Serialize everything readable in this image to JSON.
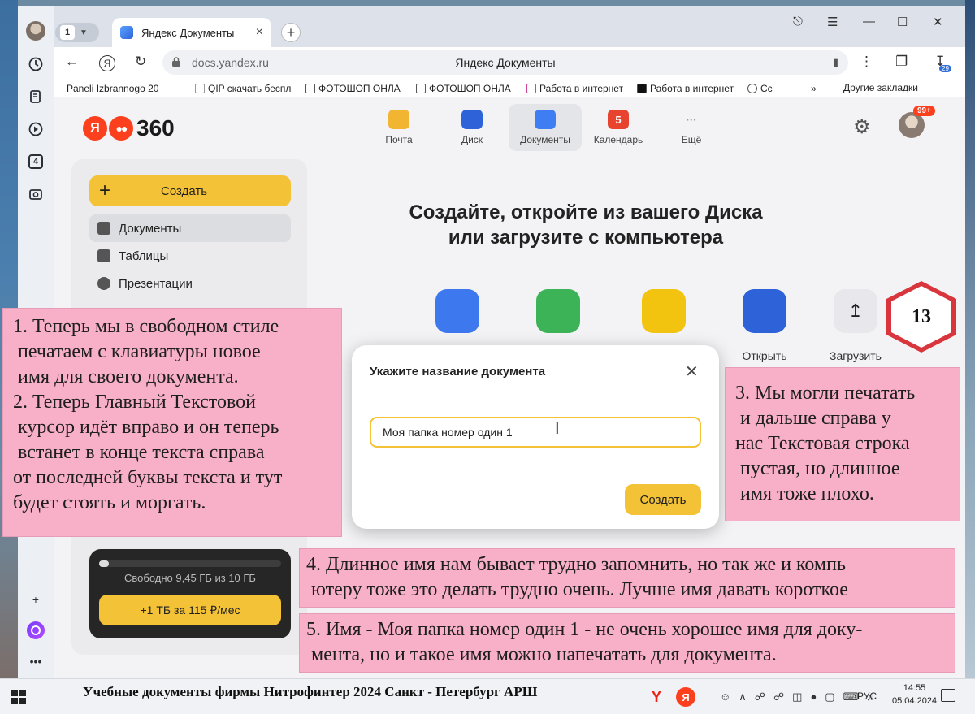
{
  "browser": {
    "tab_count": "1",
    "tab_title": "Яндекс Документы",
    "url": "docs.yandex.ru",
    "page_title": "Яндекс Документы",
    "downloads_badge": "29",
    "bookmarks": [
      "Paneli Izbrannogo 20",
      "QIP скачать беспл",
      "ФОТОШОП ОНЛА",
      "ФОТОШОП ОНЛА",
      "Работа в интернет",
      "Работа в интернет",
      "Сс"
    ],
    "bookmarks_more": "»",
    "bookmarks_other": "Другие закладки"
  },
  "sidepanel": {
    "badge_number": "4"
  },
  "header": {
    "logo_ya": "Я",
    "logo_360": "360",
    "services": [
      {
        "label": "Почта",
        "color": "#f2b531"
      },
      {
        "label": "Диск",
        "color": "#2e62d9"
      },
      {
        "label": "Документы",
        "color": "#3f7df2"
      },
      {
        "label": "Календарь",
        "color": "#e8432f",
        "icon_text": "5"
      },
      {
        "label": "Ещё",
        "color": "#c9cbd1",
        "icon_text": "···"
      }
    ],
    "user_badge": "99+"
  },
  "sidebar": {
    "create_label": "Создать",
    "items": [
      {
        "label": "Документы"
      },
      {
        "label": "Таблицы"
      },
      {
        "label": "Презентации"
      }
    ],
    "storage_text": "Свободно 9,45 ГБ из 10 ГБ",
    "storage_used_fraction": 0.055,
    "storage_button": "+1 ТБ за 115 ₽/мес"
  },
  "main": {
    "title_line1": "Создайте, откройте из вашего Диска",
    "title_line2": "или загрузите с компьютера",
    "tiles": [
      {
        "label": "",
        "color": "#3d78ee"
      },
      {
        "label": "",
        "color": "#3db357"
      },
      {
        "label": "",
        "color": "#f2c40f"
      },
      {
        "label": "Открыть",
        "color": "#2e62d9"
      },
      {
        "label": "Загрузить",
        "color": "#ececef"
      }
    ]
  },
  "dialog": {
    "title": "Укажите название документа",
    "input_value": "Моя папка номер один 1",
    "button": "Создать"
  },
  "annotations": {
    "note1": "1. Теперь мы в свободном стиле\n печатаем с клавиатуры новое\n имя для своего документа.\n2. Теперь Главный Текстовой\n курсор идёт вправо и он теперь\n встанет в конце текста справа\nот последней буквы текста и тут\nбудет стоять и моргать.",
    "note3": "3. Мы могли печатать\n и дальше справа у\nнас Текстовая строка\n пустая, но длинное\n имя тоже плохо.",
    "note4": "4. Длинное имя нам бывает трудно запомнить, но так же и компь\n ютеру тоже это делать трудно очень. Лучше имя давать короткое",
    "note5": "5. Имя - Моя папка номер один 1 - не очень хорошее имя для доку-\n мента, но и такое имя можно напечатать для документа.",
    "step_number": "13"
  },
  "taskbar": {
    "caption": "Учебные документы фирмы Нитрофинтер 2024 Санкт - Петербург АРШ",
    "app1": "Y",
    "app2": "Я",
    "language": "РУС",
    "time": "14:55",
    "date": "05.04.2024"
  }
}
